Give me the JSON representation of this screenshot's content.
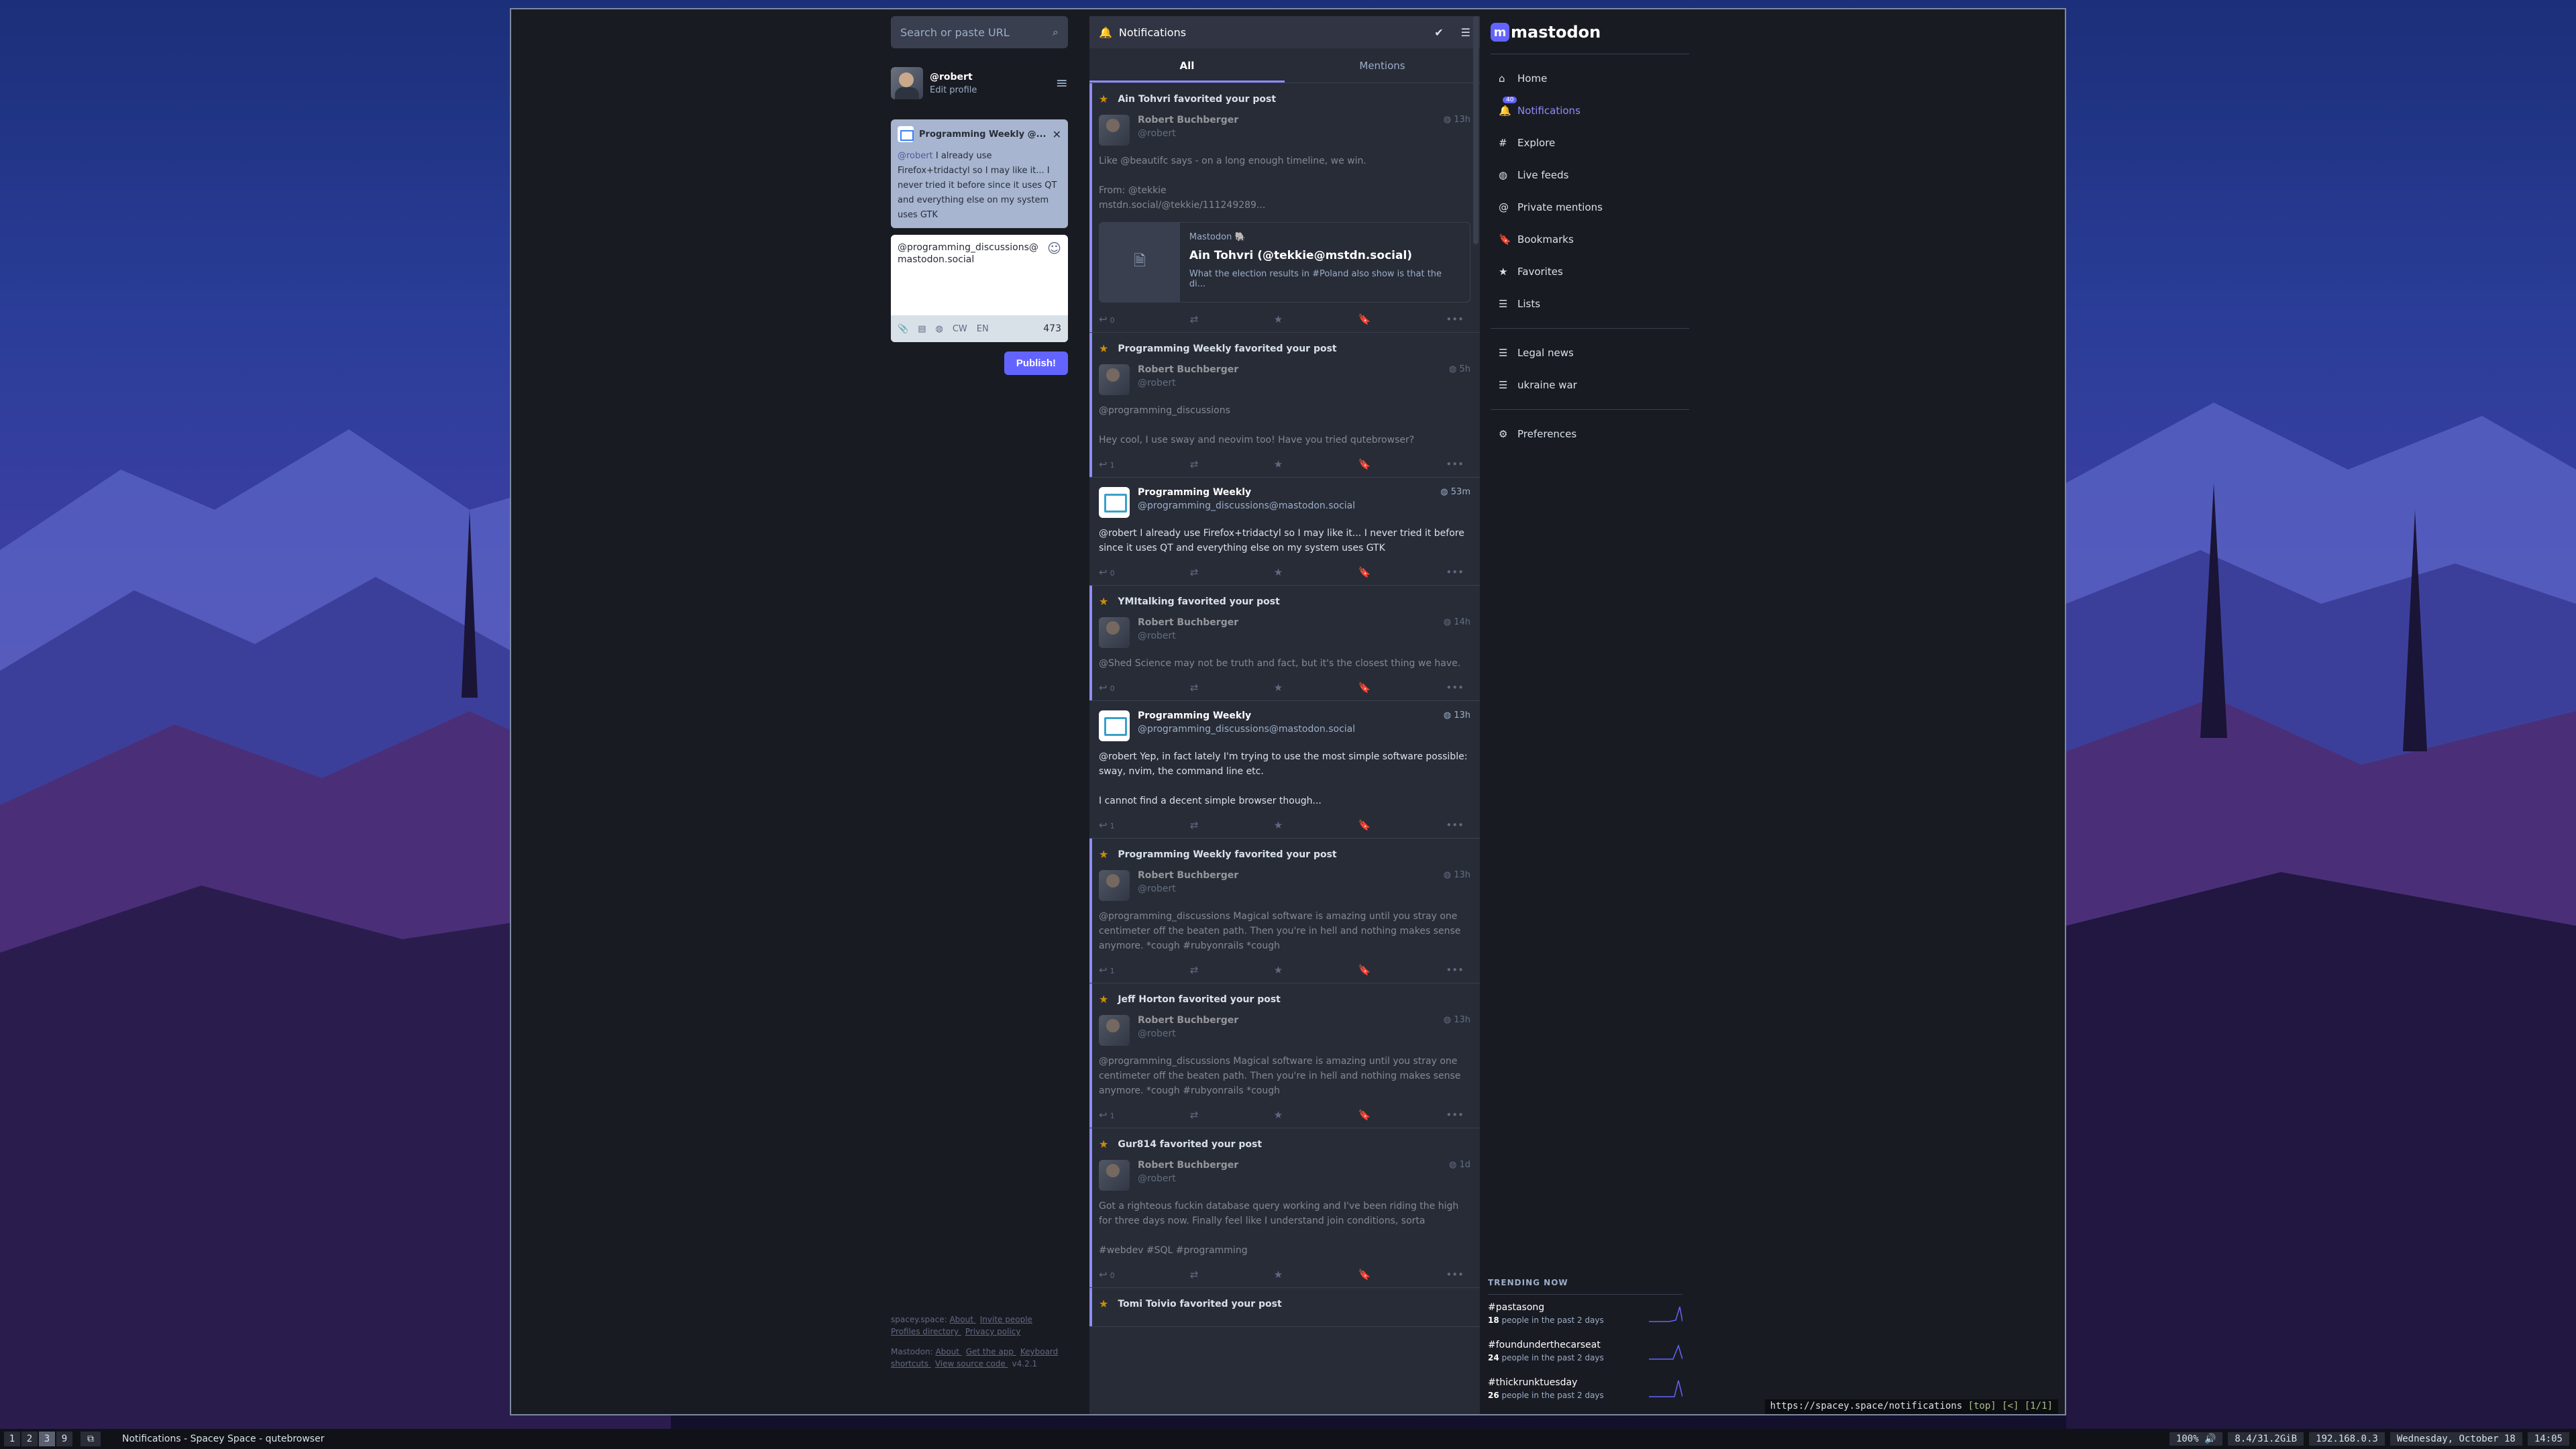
{
  "compose": {
    "search_placeholder": "Search or paste URL",
    "profile": {
      "handle": "@robert",
      "edit_label": "Edit profile"
    },
    "reply_to": {
      "name": "Programming Weekly @...",
      "mention": "@robert",
      "text": " I already use Firefox+tridactyl so I may like it... I never tried it before since it uses QT and everything else on my system uses GTK"
    },
    "textarea_value": "@programming_discussions@mastodon.social",
    "toolbar": {
      "cw": "CW",
      "lang": "EN",
      "char_count": "473"
    },
    "publish_label": "Publish!",
    "footer": {
      "line1": [
        "spacey.space:",
        "About",
        "Invite people",
        "Profiles directory",
        "Privacy policy"
      ],
      "line2": [
        "Mastodon:",
        "About",
        "Get the app",
        "Keyboard shortcuts",
        "View source code",
        "v4.2.1"
      ]
    }
  },
  "notifications": {
    "title": "Notifications",
    "tabs": [
      "All",
      "Mentions"
    ],
    "items": [
      {
        "type": "fav",
        "by": "Ain Tohvri favorited your post",
        "name": "Robert Buchberger",
        "acct": "@robert",
        "time": "13h",
        "paras": [
          "Like @beautifc says - on a long enough timeline, we win.",
          "From: @tekkie\nmstdn.social/@tekkie/111249289..."
        ],
        "card": {
          "provider": "Mastodon 🐘",
          "title": "Ain Tohvri (@tekkie@mstdn.social)",
          "desc": "What the election results in #Poland also show is that the di..."
        },
        "replies": "0"
      },
      {
        "type": "fav",
        "by": "Programming Weekly favorited your post",
        "name": "Robert Buchberger",
        "acct": "@robert",
        "time": "5h",
        "paras": [
          "@programming_discussions",
          "Hey cool, I use sway and neovim too! Have you tried qutebrowser?"
        ],
        "replies": "1"
      },
      {
        "type": "mention",
        "name": "Programming Weekly",
        "acct": "@programming_discussions@mastodon.social",
        "time": "53m",
        "paras": [
          "@robert I already use Firefox+tridactyl so I may like it... I never tried it before since it uses QT and everything else on my system uses GTK"
        ],
        "replies": "0"
      },
      {
        "type": "fav",
        "by": "YMItalking favorited your post",
        "name": "Robert Buchberger",
        "acct": "@robert",
        "time": "14h",
        "paras": [
          "@Shed Science may not be truth and fact, but it's the closest thing we have."
        ],
        "replies": "0"
      },
      {
        "type": "mention",
        "name": "Programming Weekly",
        "acct": "@programming_discussions@mastodon.social",
        "time": "13h",
        "paras": [
          "@robert Yep, in fact lately I'm trying to use the most simple software possible: sway, nvim, the command line etc.",
          "I cannot find a decent simple browser though..."
        ],
        "replies": "1"
      },
      {
        "type": "fav",
        "by": "Programming Weekly favorited your post",
        "name": "Robert Buchberger",
        "acct": "@robert",
        "time": "13h",
        "paras": [
          "@programming_discussions Magical software is amazing until you stray one centimeter off the beaten path. Then you're in hell and nothing makes sense anymore. *cough #rubyonrails *cough"
        ],
        "replies": "1"
      },
      {
        "type": "fav",
        "by": "Jeff Horton favorited your post",
        "name": "Robert Buchberger",
        "acct": "@robert",
        "time": "13h",
        "paras": [
          "@programming_discussions Magical software is amazing until you stray one centimeter off the beaten path. Then you're in hell and nothing makes sense anymore. *cough #rubyonrails *cough"
        ],
        "replies": "1"
      },
      {
        "type": "fav",
        "by": "Gur814 favorited your post",
        "name": "Robert Buchberger",
        "acct": "@robert",
        "time": "1d",
        "paras": [
          "Got a righteous fuckin database query working and I've been riding the high for three days now. Finally feel like I understand join conditions, sorta",
          "#webdev #SQL #programming"
        ],
        "replies": "0"
      },
      {
        "type": "fav",
        "by": "Tomi Toivio favorited your post",
        "name": "",
        "acct": "",
        "time": "",
        "paras": [],
        "replies": ""
      }
    ]
  },
  "nav": {
    "logo": "mastodon",
    "items": [
      {
        "label": "Home",
        "icon": "home-icon"
      },
      {
        "label": "Notifications",
        "icon": "bell-icon",
        "badge": "40",
        "active": true
      },
      {
        "label": "Explore",
        "icon": "hashtag-icon"
      },
      {
        "label": "Live feeds",
        "icon": "globe-icon"
      },
      {
        "label": "Private mentions",
        "icon": "at-icon"
      },
      {
        "label": "Bookmarks",
        "icon": "bookmark-icon"
      },
      {
        "label": "Favorites",
        "icon": "star-icon"
      },
      {
        "label": "Lists",
        "icon": "list-icon"
      }
    ],
    "lists": [
      {
        "label": "Legal news",
        "icon": "list-icon"
      },
      {
        "label": "ukraine war",
        "icon": "list-icon"
      }
    ],
    "preferences": "Preferences",
    "trending_title": "TRENDING NOW",
    "trending": [
      {
        "tag": "#pastasong",
        "count": "18",
        "sub": " people in the past 2 days"
      },
      {
        "tag": "#foundunderthecarseat",
        "count": "24",
        "sub": " people in the past 2 days"
      },
      {
        "tag": "#thickrunktuesday",
        "count": "26",
        "sub": " people in the past 2 days"
      }
    ]
  },
  "browser": {
    "url": "https://spacey.space/notifications",
    "url_suffix": " [top] [<] [1/1]"
  },
  "taskbar": {
    "workspaces": [
      "1",
      "2",
      "3",
      "9"
    ],
    "active_workspace": "3",
    "title": "Notifications - Spacey Space - qutebrowser",
    "volume": "100% 🔊",
    "memory": "8.4/31.2GiB",
    "ip": "192.168.0.3",
    "date": "Wednesday, October 18",
    "time": "14:05"
  }
}
